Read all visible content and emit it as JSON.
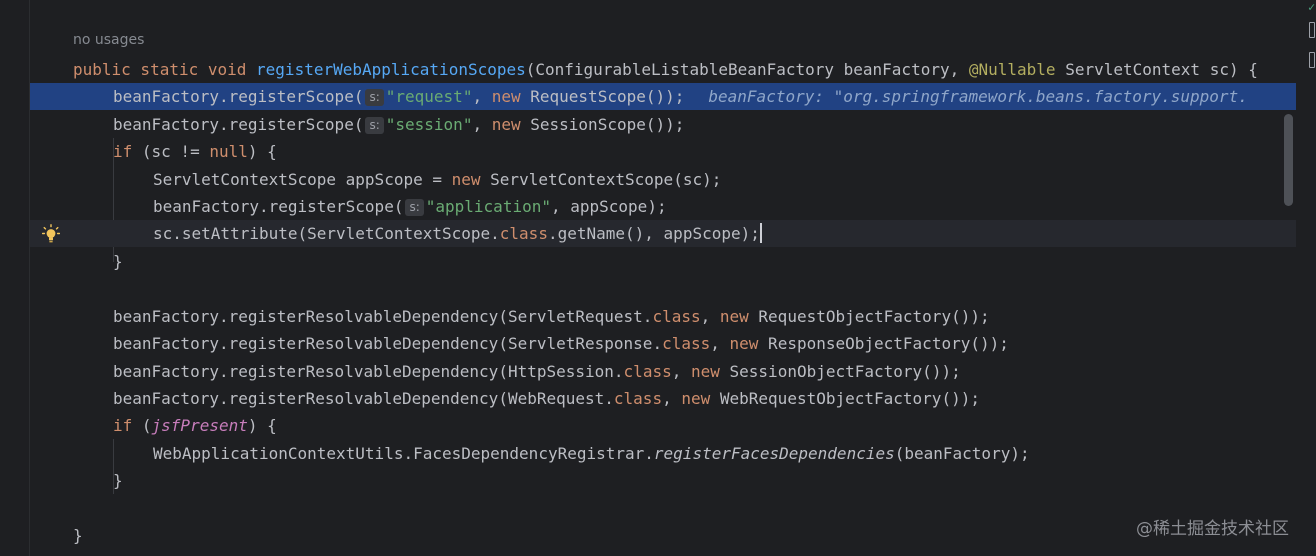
{
  "editor": {
    "usages_hint": "no usages",
    "lines": {
      "sig": {
        "kw1": "public static void ",
        "method": "registerWebApplicationScopes",
        "p1": "(ConfigurableListableBeanFactory beanFactory, ",
        "annotation": "@Nullable",
        "p2": " ServletContext sc) {"
      },
      "l2": {
        "a": "beanFactory.registerScope(",
        "hint": "s:",
        "str": "\"request\"",
        "b": ", ",
        "kw": "new",
        "c": " RequestScope());",
        "inline_value": "beanFactory: \"org.springframework.beans.factory.support."
      },
      "l3": {
        "a": "beanFactory.registerScope(",
        "hint": "s:",
        "str": "\"session\"",
        "b": ", ",
        "kw": "new",
        "c": " SessionScope());"
      },
      "l4": {
        "kw": "if",
        "a": " (sc != ",
        "kw2": "null",
        "b": ") {"
      },
      "l5": {
        "a": "ServletContextScope appScope = ",
        "kw": "new",
        "b": " ServletContextScope(sc);"
      },
      "l6": {
        "a": "beanFactory.registerScope(",
        "hint": "s:",
        "str": "\"application\"",
        "b": ", appScope);"
      },
      "l7": {
        "a": "sc.setAttribute(ServletContextScope.",
        "kw": "class",
        "b": ".getName(), appScope);"
      },
      "l8": {
        "a": "}"
      },
      "l10": {
        "a": "beanFactory.registerResolvableDependency(ServletRequest.",
        "kw": "class",
        "b": ", ",
        "kw2": "new",
        "c": " RequestObjectFactory());"
      },
      "l11": {
        "a": "beanFactory.registerResolvableDependency(ServletResponse.",
        "kw": "class",
        "b": ", ",
        "kw2": "new",
        "c": " ResponseObjectFactory());"
      },
      "l12": {
        "a": "beanFactory.registerResolvableDependency(HttpSession.",
        "kw": "class",
        "b": ", ",
        "kw2": "new",
        "c": " SessionObjectFactory());"
      },
      "l13": {
        "a": "beanFactory.registerResolvableDependency(WebRequest.",
        "kw": "class",
        "b": ", ",
        "kw2": "new",
        "c": " WebRequestObjectFactory());"
      },
      "l14": {
        "kw": "if",
        "a": " (",
        "field": "jsfPresent",
        "b": ") {"
      },
      "l15": {
        "a": "WebApplicationContextUtils.FacesDependencyRegistrar.",
        "static_call": "registerFacesDependencies",
        "b": "(beanFactory);"
      },
      "l16": {
        "a": "}"
      },
      "l18": {
        "a": "}"
      }
    },
    "icons": {
      "bulb": "lightbulb-icon",
      "top_marker": "check-mark-icon"
    }
  },
  "watermark": "@稀土掘金技术社区",
  "colors": {
    "background": "#1e1f22",
    "selection": "#214283",
    "keyword": "#cf8e6d",
    "method": "#56a8f5",
    "string": "#6aab73",
    "annotation": "#b3ae60",
    "field": "#c77dbb"
  }
}
